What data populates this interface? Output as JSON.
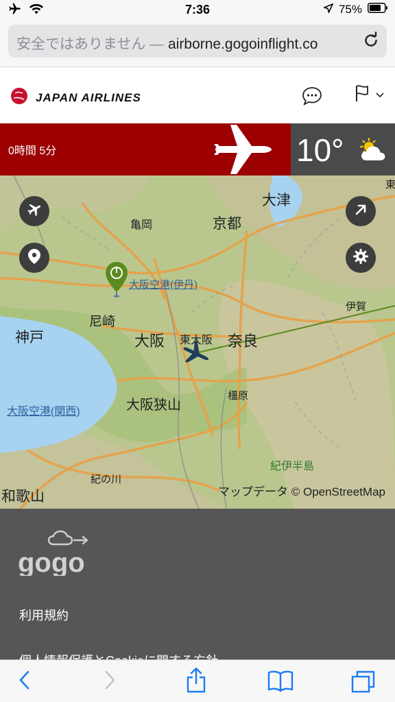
{
  "status_bar": {
    "time": "7:36",
    "battery": "75%"
  },
  "browser": {
    "url_warning": "安全ではありません —",
    "url_host": " airborne.gogoinflight.co"
  },
  "header": {
    "brand": "JAPAN AIRLINES"
  },
  "flight": {
    "remaining_time": "0時間 5分",
    "temperature": "10°"
  },
  "map": {
    "attribution": "マップデータ © OpenStreetMap",
    "labels": [
      {
        "id": "otsu",
        "text": "大津"
      },
      {
        "id": "kameoka",
        "text": "亀岡"
      },
      {
        "id": "kyoto",
        "text": "京都"
      },
      {
        "id": "itami",
        "text": "大阪空港(伊丹)"
      },
      {
        "id": "iga",
        "text": "伊賀"
      },
      {
        "id": "kobe",
        "text": "神戸"
      },
      {
        "id": "amagasaki",
        "text": "尼崎"
      },
      {
        "id": "osaka",
        "text": "大阪"
      },
      {
        "id": "higashiosaka",
        "text": "東大阪"
      },
      {
        "id": "nara",
        "text": "奈良"
      },
      {
        "id": "kansai",
        "text": "大阪空港(関西)"
      },
      {
        "id": "osakasayama",
        "text": "大阪狭山"
      },
      {
        "id": "kashihara",
        "text": "橿原"
      },
      {
        "id": "kiihanto",
        "text": "紀伊半島"
      },
      {
        "id": "kinokawa",
        "text": "紀の川"
      },
      {
        "id": "wakayama",
        "text": "和歌山"
      },
      {
        "id": "edge",
        "text": "東"
      }
    ]
  },
  "footer": {
    "logo_text": "gogo",
    "links": [
      "利用規約",
      "個人情報保護とCookieに関する方針"
    ]
  },
  "icons": {
    "airplane_mode": "airplane-icon",
    "wifi": "wifi-icon",
    "location": "location-arrow-icon",
    "battery": "battery-icon",
    "reload": "reload-icon",
    "chat": "chat-bubble-icon",
    "language": "flag-icon",
    "weather": "partly-cloudy-icon"
  },
  "colors": {
    "jal_red": "#9c0000",
    "weather_bg": "#4a4a4a",
    "footer_bg": "#565656",
    "pin_green": "#5b8a1f",
    "plane_blue": "#1f3d5c"
  }
}
